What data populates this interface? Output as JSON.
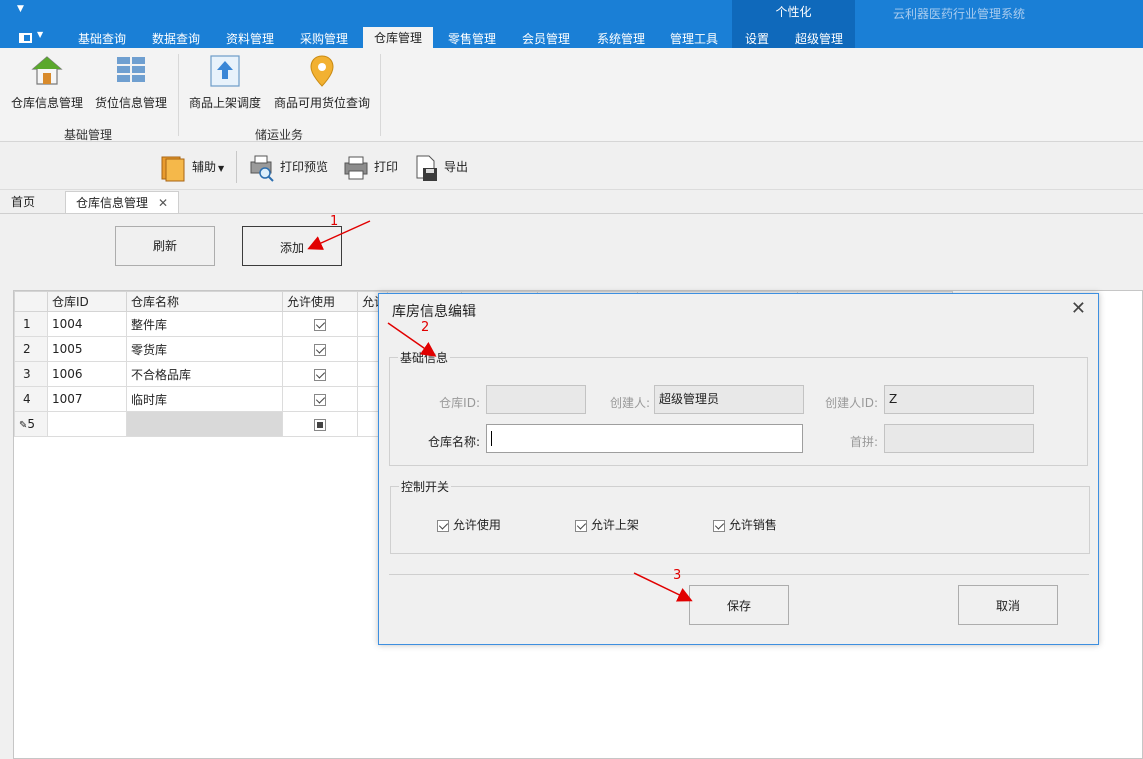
{
  "app": {
    "title": "云利器医药行业管理系统",
    "persona": "个性化"
  },
  "ribbon_tabs": [
    "基础查询",
    "数据查询",
    "资料管理",
    "采购管理",
    "仓库管理",
    "零售管理",
    "会员管理",
    "系统管理",
    "管理工具",
    "设置",
    "超级管理"
  ],
  "active_tab": "仓库管理",
  "ribbon": {
    "buttons": [
      "仓库信息管理",
      "货位信息管理",
      "商品上架调度",
      "商品可用货位查询"
    ],
    "groups": [
      "基础管理",
      "储运业务"
    ]
  },
  "toolbar": {
    "assist": "辅助",
    "print_preview": "打印预览",
    "print": "打印",
    "export": "导出"
  },
  "doc_tabs": {
    "home": "首页",
    "active": "仓库信息管理"
  },
  "buttons": {
    "refresh": "刷新",
    "add": "添加"
  },
  "grid": {
    "headers": [
      "仓库ID",
      "仓库名称",
      "允许使用",
      "允许"
    ],
    "rows": [
      {
        "num": "1",
        "id": "1004",
        "name": "整件库"
      },
      {
        "num": "2",
        "id": "1005",
        "name": "零货库"
      },
      {
        "num": "3",
        "id": "1006",
        "name": "不合格品库"
      },
      {
        "num": "4",
        "id": "1007",
        "name": "临时库"
      }
    ],
    "new_row_num": "5"
  },
  "dialog": {
    "title": "库房信息编辑",
    "basic_legend": "基础信息",
    "labels": {
      "id": "仓库ID:",
      "creator": "创建人:",
      "creator_id": "创建人ID:",
      "name": "仓库名称:",
      "pinyin": "首拼:"
    },
    "values": {
      "id": "",
      "creator": "超级管理员",
      "creator_id": "Z",
      "name": "",
      "pinyin": ""
    },
    "control_legend": "控制开关",
    "checks": [
      "允许使用",
      "允许上架",
      "允许销售"
    ],
    "save": "保存",
    "cancel": "取消"
  },
  "annotations": [
    "1",
    "2",
    "3"
  ],
  "colors": {
    "title_bar": "#1a7fd6",
    "persona_bg": "#0f69bb",
    "arrow": "#e10000",
    "dialog_border": "#3d8fe0"
  }
}
